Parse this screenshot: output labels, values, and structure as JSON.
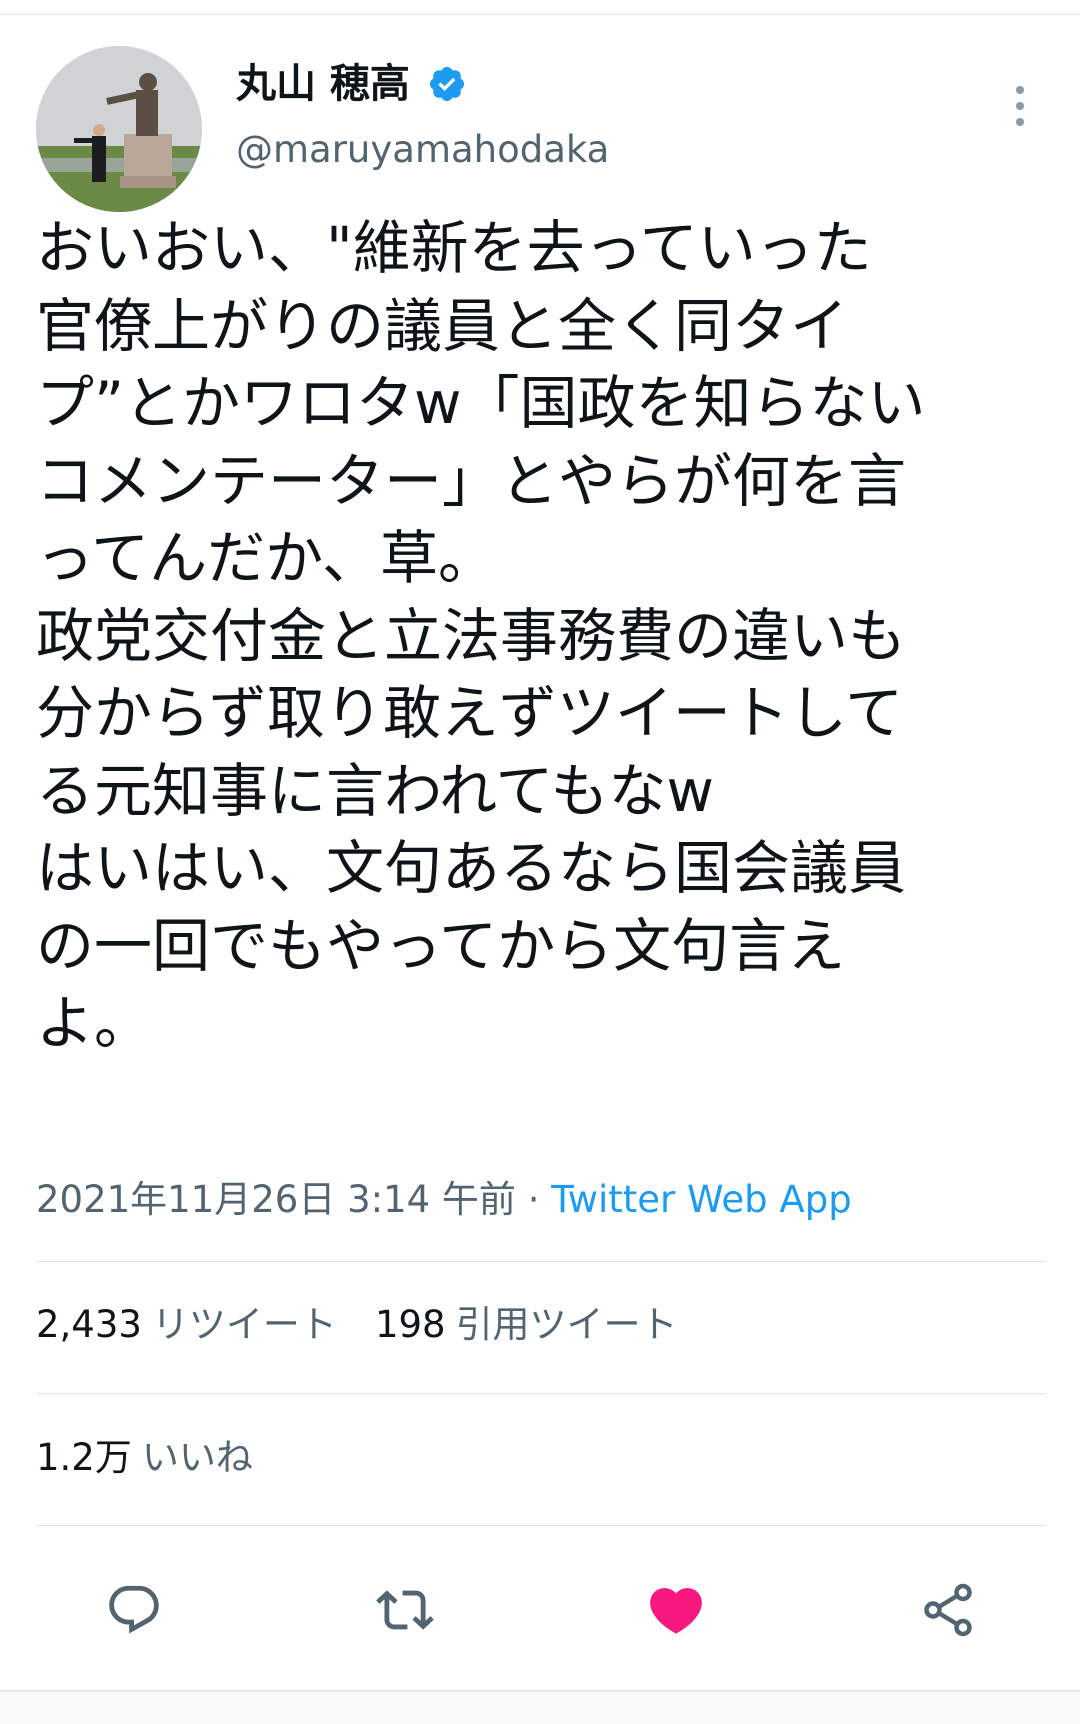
{
  "tweet": {
    "author": {
      "display_name": "丸山 穂高",
      "handle": "@maruyamahodaka",
      "verified": true
    },
    "text_lines": [
      "おいおい、\"維新を去っていった",
      "官僚上がりの議員と全く同タイ",
      "プ”とかワロタw「国政を知らない",
      "コメンテーター」とやらが何を言",
      "ってんだか、草。",
      "政党交付金と立法事務費の違いも",
      "分からず取り敢えずツイートして",
      "る元知事に言われてもなw",
      "はいはい、文句あるなら国会議員",
      "の一回でもやってから文句言え",
      "よ。"
    ],
    "timestamp": "2021年11月26日 3:14 午前",
    "separator": " · ",
    "source": "Twitter Web App",
    "stats": {
      "retweets": {
        "count": "2,433",
        "label": "リツイート"
      },
      "quotes": {
        "count": "198",
        "label": "引用ツイート"
      },
      "likes": {
        "count": "1.2万",
        "label": "いいね"
      }
    }
  },
  "icons": {
    "verified": "verified-badge-icon",
    "more": "more-vertical-icon",
    "reply": "reply-icon",
    "retweet": "retweet-icon",
    "like": "heart-icon",
    "share": "share-icon"
  },
  "colors": {
    "accent": "#1d9bf0",
    "like": "#f91880",
    "secondary_text": "#536471",
    "action_icon": "#536471"
  }
}
